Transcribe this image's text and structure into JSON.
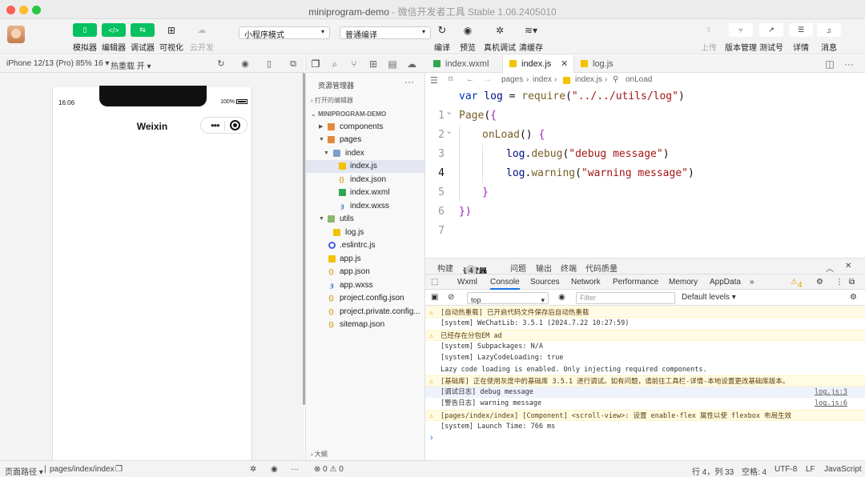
{
  "window": {
    "title": "miniprogram-demo",
    "subtitle": " - 微信开发者工具 Stable 1.06.2405010"
  },
  "toolbar": {
    "left_buttons": [
      {
        "label": "模拟器",
        "icon": "phone-icon"
      },
      {
        "label": "编辑器",
        "icon": "code-icon"
      },
      {
        "label": "调试器",
        "icon": "debug-icon"
      },
      {
        "label": "可视化",
        "icon": "layout-icon"
      },
      {
        "label": "云开发",
        "icon": "cloud-icon"
      }
    ],
    "mode_select": "小程序模式",
    "compile_select": "普通编译",
    "mid_buttons": [
      {
        "label": "编译"
      },
      {
        "label": "预览"
      },
      {
        "label": "真机调试"
      },
      {
        "label": "清缓存"
      }
    ],
    "right_buttons": [
      {
        "label": "上传"
      },
      {
        "label": "版本管理"
      },
      {
        "label": "测试号"
      },
      {
        "label": "详情"
      },
      {
        "label": "消息"
      }
    ]
  },
  "simbar": {
    "device": "iPhone 12/13 (Pro) 85% 16 ▾",
    "hot_reload": "热重载 开 ▾"
  },
  "phone": {
    "time": "16:06",
    "battery": "100%",
    "nav_title": "Weixin",
    "capsule_dots": "•••"
  },
  "statusbar": {
    "page_path_label": "页面路径 ▾",
    "page_path": "pages/index/index",
    "problems": "⊗ 0 ⚠ 0",
    "cursor_pos": "行 4，列 33",
    "spaces": "空格: 4",
    "encoding": "UTF-8",
    "eol": "LF",
    "language": "JavaScript"
  },
  "explorer": {
    "title": "资源管理器",
    "open_editors": "打开的编辑器",
    "project": "MINIPROGRAM-DEMO",
    "items": [
      {
        "name": "components"
      },
      {
        "name": "pages"
      },
      {
        "name": "index"
      },
      {
        "name": "index.js"
      },
      {
        "name": "index.json"
      },
      {
        "name": "index.wxml"
      },
      {
        "name": "index.wxss"
      },
      {
        "name": "utils"
      },
      {
        "name": "log.js"
      },
      {
        "name": ".eslintrc.js"
      },
      {
        "name": "app.js"
      },
      {
        "name": "app.json"
      },
      {
        "name": "app.wxss"
      },
      {
        "name": "project.config.json"
      },
      {
        "name": "project.private.config..."
      },
      {
        "name": "sitemap.json"
      }
    ],
    "outline": "大纲"
  },
  "editor": {
    "tabs": [
      {
        "label": "index.wxml"
      },
      {
        "label": "index.js"
      },
      {
        "label": "log.js"
      }
    ],
    "breadcrumb": {
      "a": "pages",
      "b": "index",
      "c": "index.js",
      "d": "onLoad"
    },
    "lines": {
      "l1": {
        "n": "1",
        "kw": "var",
        "var": " log",
        "eq": " = ",
        "fn": "require",
        "p1": "(",
        "str": "\"../../utils/log\"",
        "p2": ")"
      },
      "l2": {
        "n": "2",
        "fn": "Page",
        "p1": "(",
        "br": "{"
      },
      "l3": {
        "n": "3",
        "fn": "onLoad",
        "p1": "() ",
        "br": "{"
      },
      "l4": {
        "n": "4",
        "var": "log",
        "dot": ".",
        "fn": "debug",
        "p1": "(",
        "str": "\"debug message\"",
        "p2": ")"
      },
      "l5": {
        "n": "5",
        "var": "log",
        "dot": ".",
        "fn": "warning",
        "p1": "(",
        "str": "\"warning message\"",
        "p2": ")"
      },
      "l6": {
        "n": "6",
        "br": "}"
      },
      "l7": {
        "n": "7",
        "br": "})"
      }
    }
  },
  "panel": {
    "tabs": [
      {
        "label": "构建"
      },
      {
        "label": "调试器"
      },
      {
        "label": "问题"
      },
      {
        "label": "输出"
      },
      {
        "label": "终端"
      },
      {
        "label": "代码质量"
      }
    ],
    "debugger_badge": "4",
    "devtools_tabs": [
      "Wxml",
      "Console",
      "Sources",
      "Network",
      "Performance",
      "Memory",
      "AppData"
    ],
    "more": "»",
    "warn_count": "4",
    "context": "top",
    "filter_placeholder": "Filter",
    "levels": "Default levels ▾"
  },
  "console_logs": [
    {
      "type": "warn",
      "text": "[自动热重载] 已开启代码文件保存后自动热重载",
      "src": ""
    },
    {
      "type": "info",
      "text": "[system] WeChatLib: 3.5.1 (2024.7.22 10:27:59)",
      "src": ""
    },
    {
      "type": "warn",
      "text": "已经存在分包EM ad",
      "src": ""
    },
    {
      "type": "info",
      "text": "[system] Subpackages: N/A",
      "src": ""
    },
    {
      "type": "info",
      "text": "[system] LazyCodeLoading: true",
      "src": ""
    },
    {
      "type": "info",
      "text": "Lazy code loading is enabled. Only injecting required components.",
      "src": ""
    },
    {
      "type": "warn",
      "text": "[基础库] 正在使用灰度中的基础库 3.5.1 进行调试。如有问题，请前往工具栏-详情-本地设置更改基础库版本。",
      "src": ""
    },
    {
      "type": "debug",
      "text": "[调试日志] debug message",
      "src": "log.js:3"
    },
    {
      "type": "info",
      "text": "[警告日志] warning message",
      "src": "log.js:6"
    },
    {
      "type": "warn",
      "text": "[pages/index/index] [Component] <scroll-view>: 设置 enable-flex 属性以使 flexbox 布局生效",
      "src": ""
    },
    {
      "type": "info",
      "text": "[system] Launch Time: 766 ms",
      "src": ""
    }
  ],
  "colors": {
    "accent_green": "#07c160",
    "warning_bg": "#fffbe5",
    "link_blue": "#1a73e8"
  }
}
